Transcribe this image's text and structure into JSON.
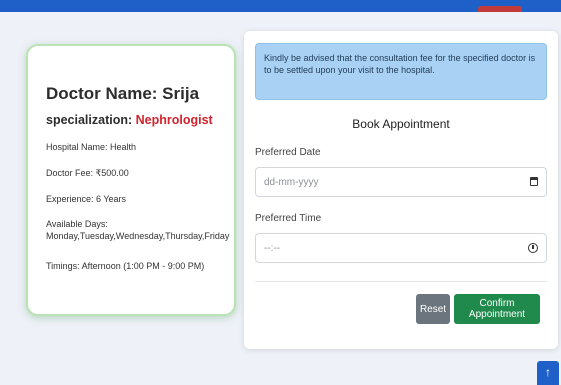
{
  "doctor": {
    "name": "Doctor Name: Srija",
    "specialization_label": "specialization:",
    "specialization_value": "Nephrologist",
    "hospital": "Hospital Name: Health",
    "fee": "Doctor Fee: ₹500.00",
    "experience": "Experience: 6 Years",
    "days_label": "Available Days:",
    "days_value": "Monday,Tuesday,Wednesday,Thursday,Friday",
    "timings": "Timings: Afternoon (1:00 PM - 9:00 PM)"
  },
  "booking": {
    "notice": "Kindly be advised that the consultation fee for the specified doctor is to be settled upon your visit to the hospital.",
    "title": "Book Appointment",
    "date_label": "Preferred Date",
    "date_placeholder": "dd-mm-yyyy",
    "time_label": "Preferred Time",
    "time_placeholder": "--:--",
    "reset_label": "Reset",
    "confirm_label": "Confirm Appointment"
  },
  "scroll_top_icon": "↑",
  "icons": {
    "date": "calendar-icon",
    "time": "clock-icon",
    "scroll": "arrow-up-icon"
  },
  "colors": {
    "brand": "#1e60c8",
    "specialization": "#d0232d",
    "confirm": "#1f8a4c",
    "reset": "#6c757d",
    "notice_bg": "#a9d1f4"
  }
}
